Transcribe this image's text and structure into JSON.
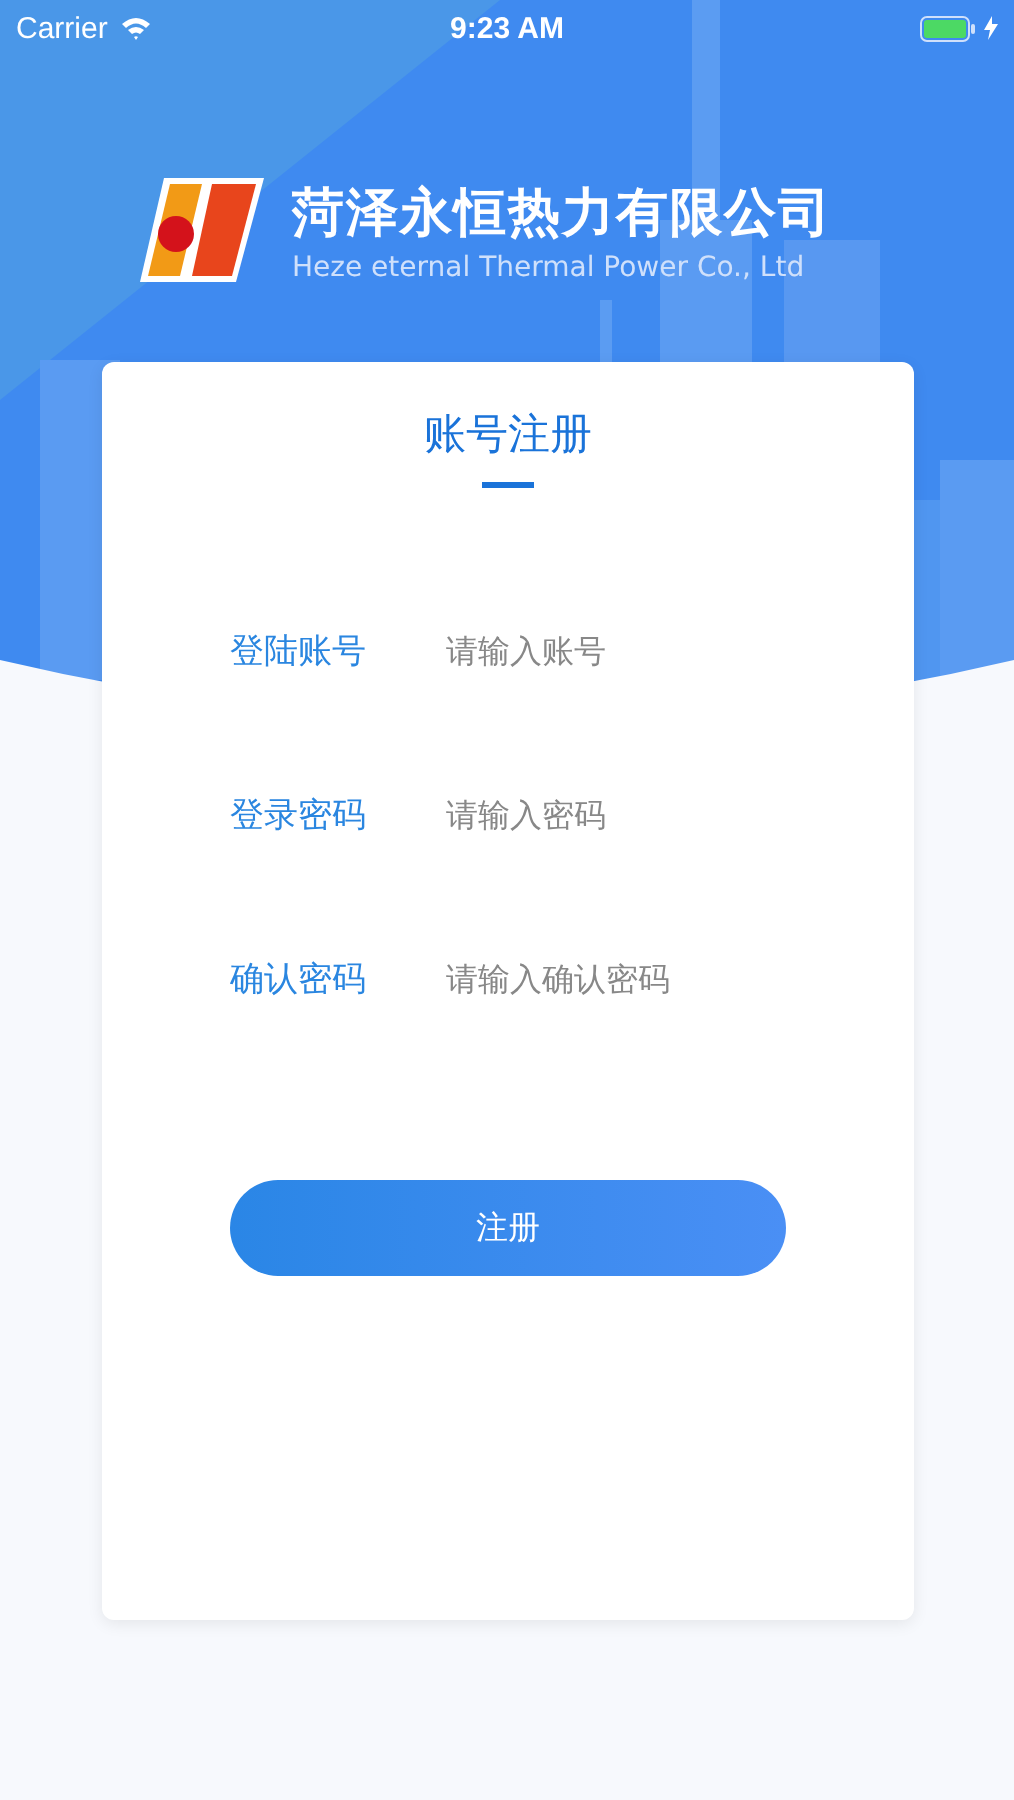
{
  "status_bar": {
    "carrier": "Carrier",
    "time": "9:23 AM",
    "charging": true
  },
  "brand": {
    "name": "菏泽永恒热力有限公司",
    "subtitle": "Heze eternal Thermal Power Co., Ltd"
  },
  "form": {
    "title": "账号注册",
    "fields": [
      {
        "label": "登陆账号",
        "placeholder": "请输入账号"
      },
      {
        "label": "登录密码",
        "placeholder": "请输入密码"
      },
      {
        "label": "确认密码",
        "placeholder": "请输入确认密码"
      }
    ],
    "submit": "注册"
  }
}
